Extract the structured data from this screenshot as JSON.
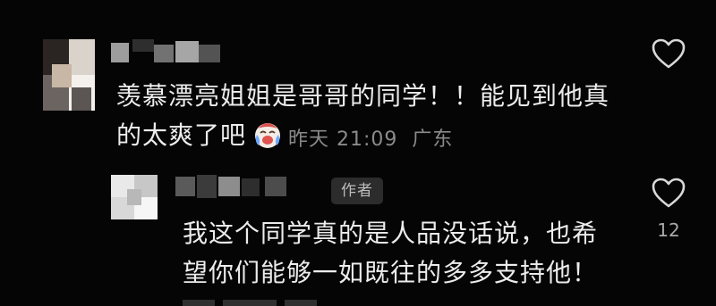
{
  "comments": [
    {
      "text": "羡慕漂亮姐姐是哥哥的同学！！能见到他真\n的太爽了吧",
      "emoji_icon": "crying-laughing-face-emoji",
      "time": "昨天 21:09",
      "location": "广东",
      "like_icon": "heart-outline-icon"
    }
  ],
  "reply": {
    "badge": "作者",
    "text": "我这个同学真的是人品没话说，也希\n望你们能够一如既往的多多支持他！",
    "like_count": "12",
    "like_icon": "heart-outline-icon"
  },
  "colors": {
    "background": "#050505",
    "text": "#ececec",
    "meta": "#8a8a8a",
    "badge_bg": "#2c2c2c"
  }
}
